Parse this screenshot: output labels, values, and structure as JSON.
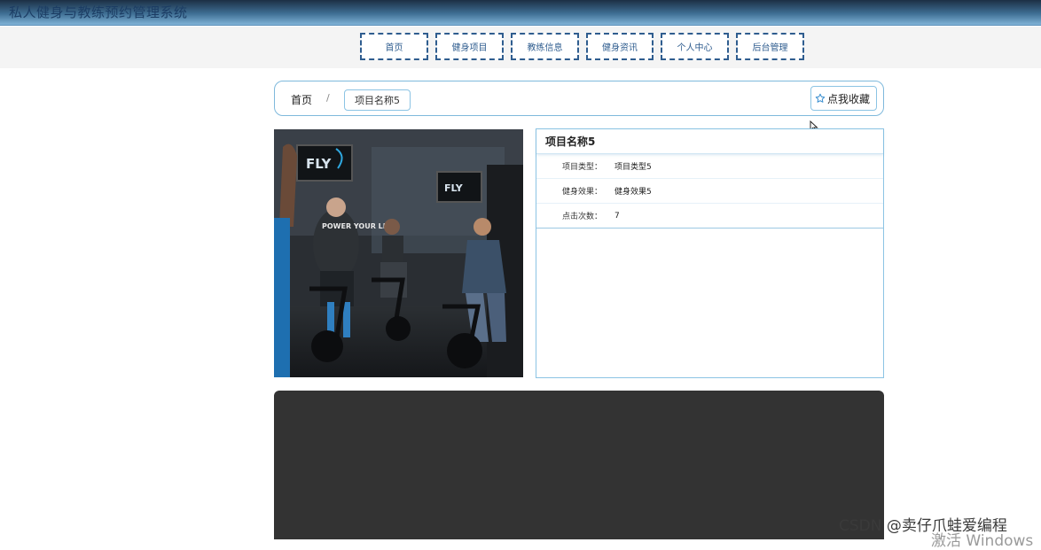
{
  "app": {
    "title": "私人健身与教练预约管理系统"
  },
  "nav": {
    "items": [
      {
        "label": "首页"
      },
      {
        "label": "健身项目"
      },
      {
        "label": "教练信息"
      },
      {
        "label": "健身资讯"
      },
      {
        "label": "个人中心"
      },
      {
        "label": "后台管理"
      }
    ]
  },
  "breadcrumb": {
    "home": "首页",
    "separator": "/",
    "current": "项目名称5"
  },
  "favorite": {
    "label": "点我收藏",
    "icon": "star-outline-icon"
  },
  "detail": {
    "title": "项目名称5",
    "rows": [
      {
        "label": "项目类型：",
        "value": "项目类型5"
      },
      {
        "label": "健身效果：",
        "value": "健身效果5"
      },
      {
        "label": "点击次数：",
        "value": "7"
      }
    ]
  },
  "image": {
    "alt_text": "FLY",
    "caption": "POWER YOUR LIFE"
  },
  "watermarks": {
    "csdn": "CSDN @卖仔爪蛙爱编程",
    "windows": "激活 Windows"
  },
  "colors": {
    "topbar": "#3f6f94",
    "nav_border": "#2f5d8f",
    "accent_border": "#8cc4e4",
    "video_bg": "#333333"
  }
}
